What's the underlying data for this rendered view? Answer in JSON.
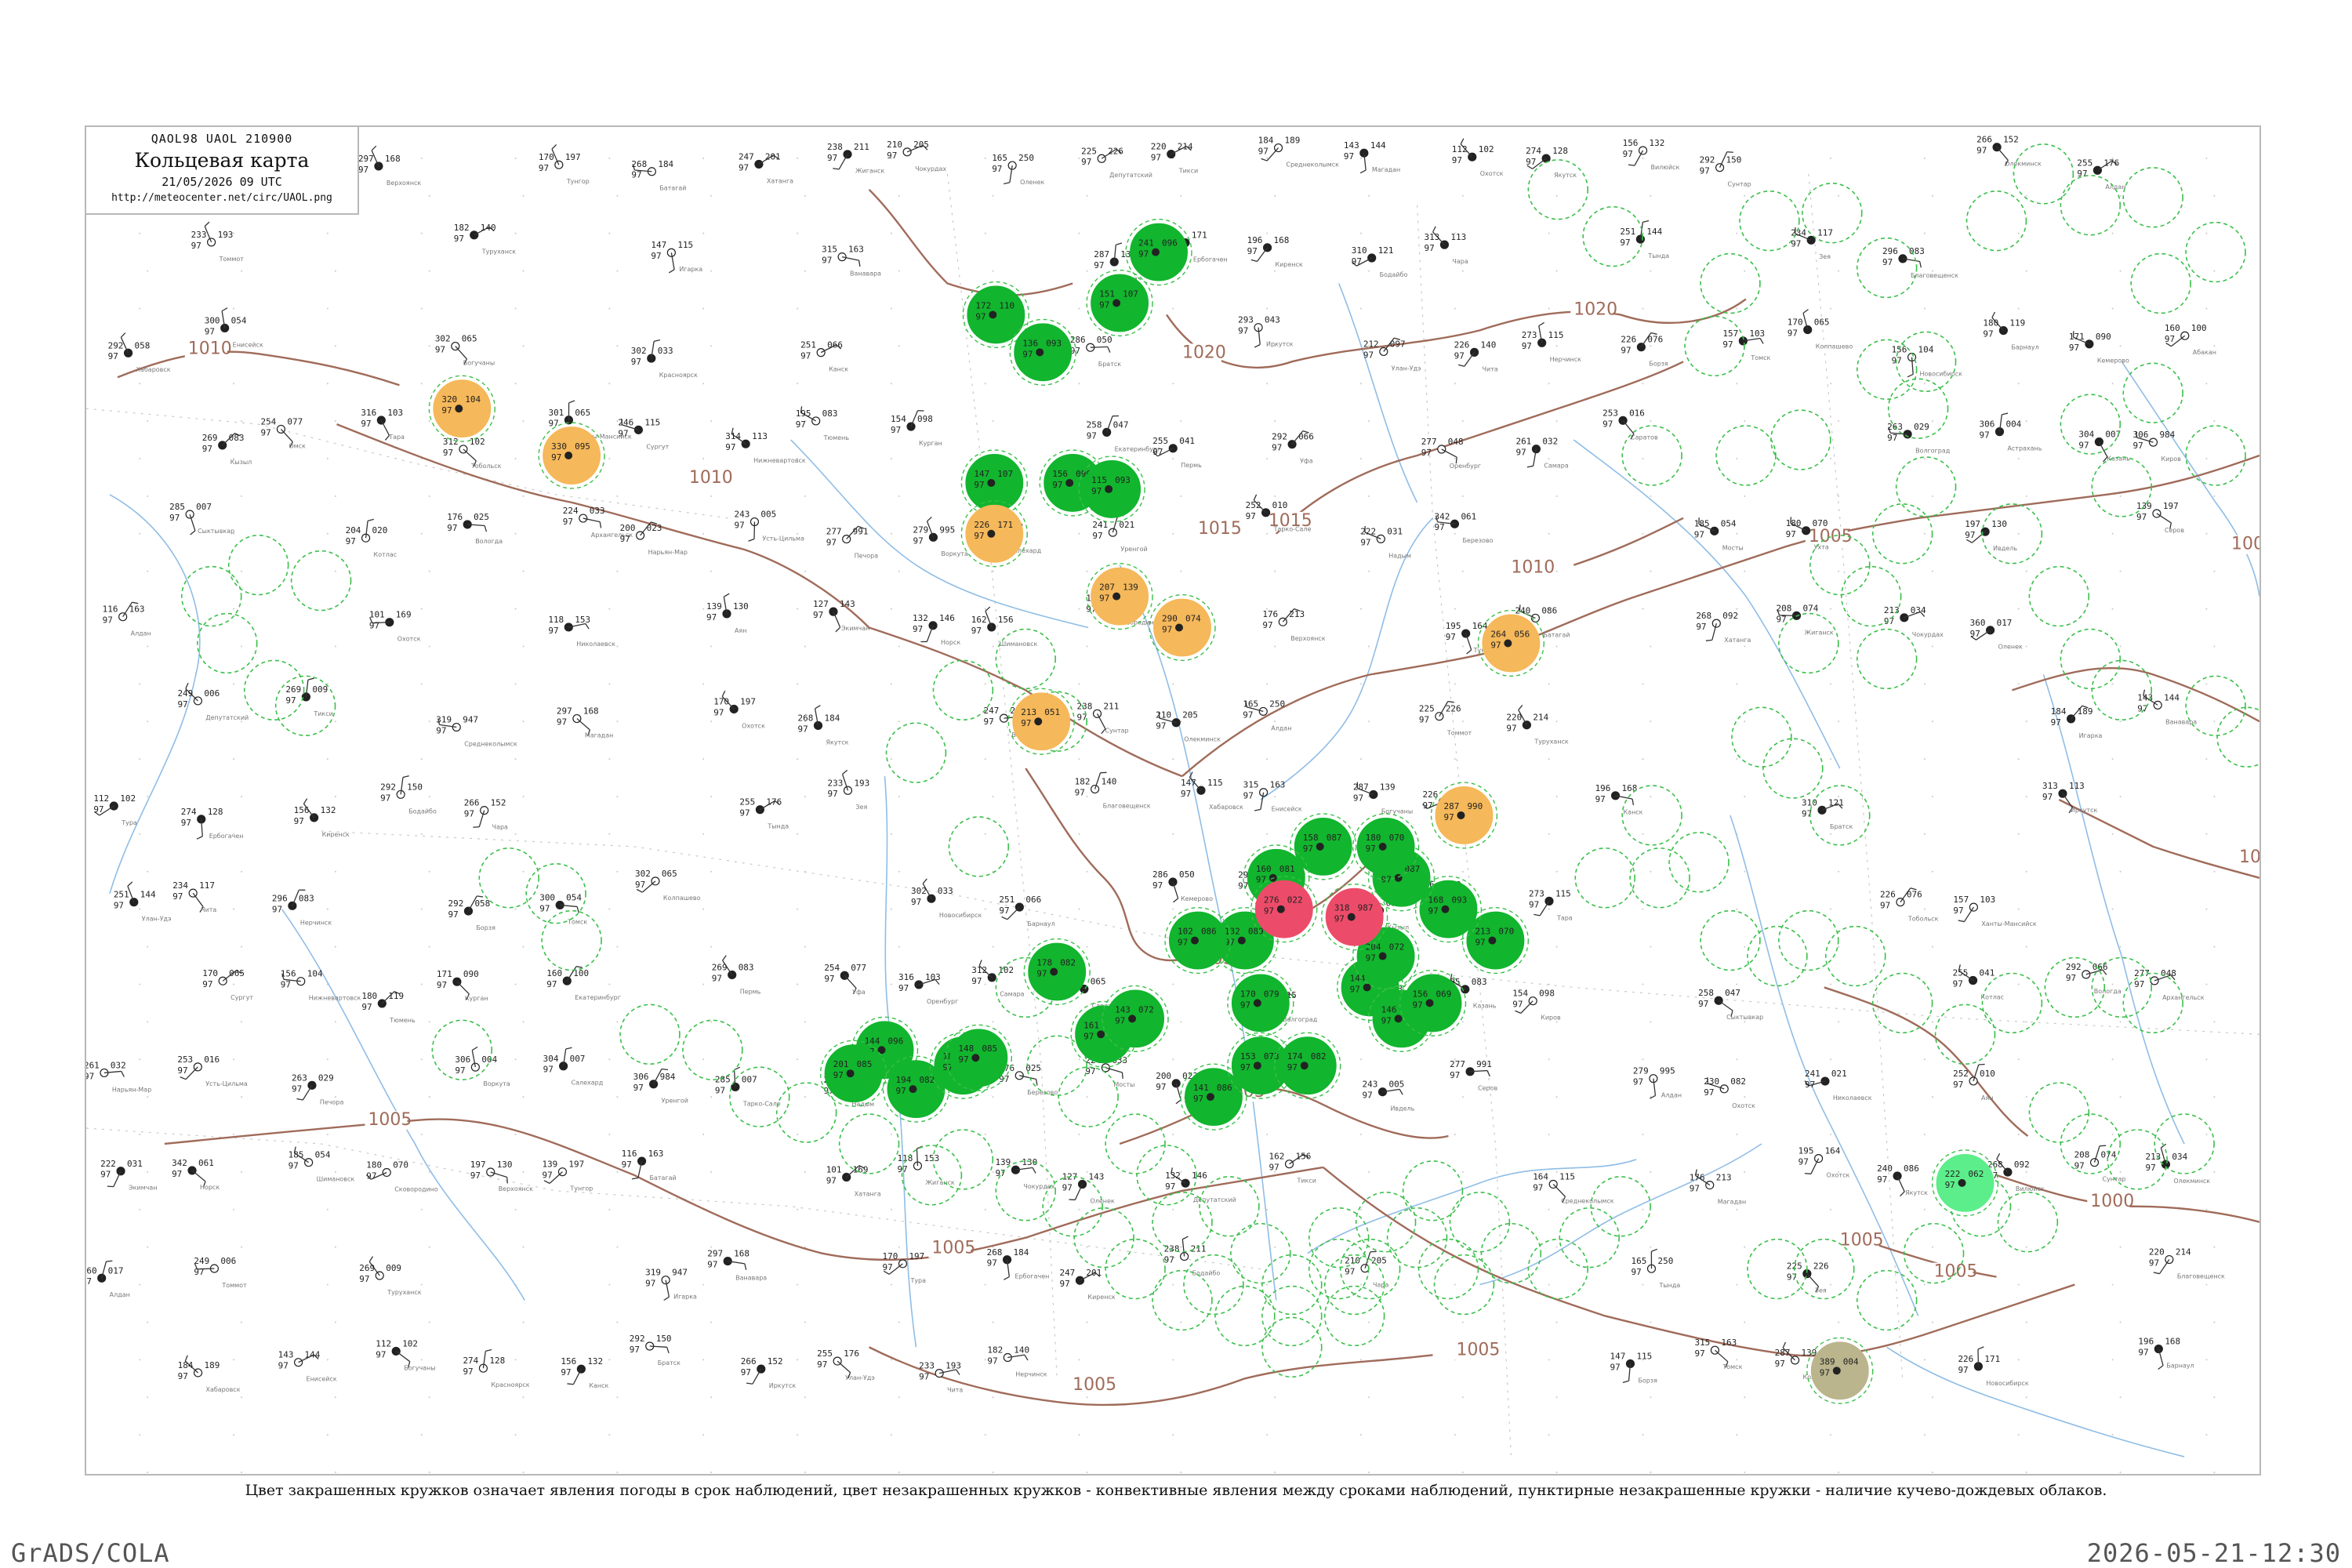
{
  "header": {
    "code": "QAOL98  UAOL  210900",
    "title": "Кольцевая карта",
    "date": "21/05/2026 09 UTC",
    "url": "http://meteocenter.net/circ/UAOL.png"
  },
  "legend_note": "Цвет закрашенных кружков означает явления погоды в срок наблюдений, цвет незакрашенных кружков - конвективные явления между сроками наблюдений, пунктирные незакрашенные кружки - наличие кучево-дождевых облаков.",
  "footer": {
    "left": "GrADS/COLA",
    "right": "2026-05-21-12:30"
  },
  "isobar_labels": [
    "1010",
    "1010",
    "1015",
    "1020",
    "1020",
    "1015",
    "1010",
    "1005",
    "1005",
    "1005",
    "1005",
    "1005",
    "1000",
    "1000",
    "1000",
    "1005",
    "1005",
    "1005",
    "1005"
  ],
  "colors": {
    "isobar": "#a06b5a",
    "river": "#8fbde6",
    "rain_filled": "#12b52e",
    "dust_orange": "#f5b85a",
    "thunder_red": "#ec4c6a",
    "light_green": "#5cee8a",
    "haze_olive": "#bab58c",
    "convective_dashed": "#3bbf4a"
  },
  "stations": {
    "filled": [
      {
        "color": "rain_filled",
        "t": "241",
        "p": "096"
      },
      {
        "color": "rain_filled",
        "t": "151",
        "p": "107"
      },
      {
        "color": "rain_filled",
        "t": "172",
        "p": "110"
      },
      {
        "color": "rain_filled",
        "t": "136",
        "p": "093"
      },
      {
        "color": "rain_filled",
        "t": "147",
        "p": "107"
      },
      {
        "color": "rain_filled",
        "t": "156",
        "p": "096"
      },
      {
        "color": "rain_filled",
        "t": "115",
        "p": "093"
      },
      {
        "color": "rain_filled",
        "t": "144",
        "p": "096"
      },
      {
        "color": "rain_filled",
        "t": "201",
        "p": "085"
      },
      {
        "color": "rain_filled",
        "t": "194",
        "p": "082"
      },
      {
        "color": "rain_filled",
        "t": "182",
        "p": "078"
      },
      {
        "color": "rain_filled",
        "t": "148",
        "p": "085"
      },
      {
        "color": "rain_filled",
        "t": "178",
        "p": "082"
      },
      {
        "color": "rain_filled",
        "t": "161",
        "p": "085"
      },
      {
        "color": "rain_filled",
        "t": "143",
        "p": "072"
      },
      {
        "color": "rain_filled",
        "t": "141",
        "p": "086"
      },
      {
        "color": "rain_filled",
        "t": "153",
        "p": "073"
      },
      {
        "color": "rain_filled",
        "t": "174",
        "p": "082"
      },
      {
        "color": "rain_filled",
        "t": "170",
        "p": "079"
      },
      {
        "color": "rain_filled",
        "t": "144",
        "p": "069"
      },
      {
        "color": "rain_filled",
        "t": "204",
        "p": "072"
      },
      {
        "color": "rain_filled",
        "t": "146",
        "p": "086"
      },
      {
        "color": "rain_filled",
        "t": "156",
        "p": "069"
      },
      {
        "color": "rain_filled",
        "t": "213",
        "p": "070"
      },
      {
        "color": "rain_filled",
        "t": "168",
        "p": "093"
      },
      {
        "color": "rain_filled",
        "t": "160",
        "p": "087"
      },
      {
        "color": "rain_filled",
        "t": "180",
        "p": "070"
      },
      {
        "color": "rain_filled",
        "t": "158",
        "p": "087"
      },
      {
        "color": "rain_filled",
        "t": "160",
        "p": "081"
      },
      {
        "color": "rain_filled",
        "t": "132",
        "p": "089"
      },
      {
        "color": "rain_filled",
        "t": "102",
        "p": "086"
      },
      {
        "color": "dust_orange",
        "t": "320",
        "p": "104"
      },
      {
        "color": "dust_orange",
        "t": "330",
        "p": "095"
      },
      {
        "color": "dust_orange",
        "t": "226",
        "p": "171"
      },
      {
        "color": "dust_orange",
        "t": "207",
        "p": "139"
      },
      {
        "color": "dust_orange",
        "t": "290",
        "p": "074"
      },
      {
        "color": "dust_orange",
        "t": "213",
        "p": "051"
      },
      {
        "color": "dust_orange",
        "t": "264",
        "p": "056"
      },
      {
        "color": "dust_orange",
        "t": "287",
        "p": "990"
      },
      {
        "color": "thunder_red",
        "t": "276",
        "p": "022"
      },
      {
        "color": "thunder_red",
        "t": "318",
        "p": "987"
      },
      {
        "color": "light_green",
        "t": "222",
        "p": "062"
      },
      {
        "color": "haze_olive",
        "t": "389",
        "p": "004"
      }
    ],
    "plots": [
      {
        "t": "297",
        "p": "168"
      },
      {
        "t": "170",
        "p": "197"
      },
      {
        "t": "268",
        "p": "184"
      },
      {
        "t": "247",
        "p": "201"
      },
      {
        "t": "238",
        "p": "211"
      },
      {
        "t": "210",
        "p": "205"
      },
      {
        "t": "165",
        "p": "250"
      },
      {
        "t": "225",
        "p": "226"
      },
      {
        "t": "220",
        "p": "214"
      },
      {
        "t": "184",
        "p": "189"
      },
      {
        "t": "143",
        "p": "144"
      },
      {
        "t": "112",
        "p": "102"
      },
      {
        "t": "274",
        "p": "128"
      },
      {
        "t": "156",
        "p": "132"
      },
      {
        "t": "292",
        "p": "150"
      },
      {
        "t": "266",
        "p": "152"
      },
      {
        "t": "255",
        "p": "176"
      },
      {
        "t": "233",
        "p": "193"
      },
      {
        "t": "182",
        "p": "140"
      },
      {
        "t": "147",
        "p": "115"
      },
      {
        "t": "315",
        "p": "163"
      },
      {
        "t": "287",
        "p": "139"
      },
      {
        "t": "226",
        "p": "171"
      },
      {
        "t": "196",
        "p": "168"
      },
      {
        "t": "310",
        "p": "121"
      },
      {
        "t": "313",
        "p": "113"
      },
      {
        "t": "251",
        "p": "144"
      },
      {
        "t": "234",
        "p": "117"
      },
      {
        "t": "296",
        "p": "083"
      },
      {
        "t": "292",
        "p": "058"
      },
      {
        "t": "300",
        "p": "054"
      },
      {
        "t": "302",
        "p": "065"
      },
      {
        "t": "302",
        "p": "033"
      },
      {
        "t": "251",
        "p": "066"
      },
      {
        "t": "286",
        "p": "050"
      },
      {
        "t": "293",
        "p": "043"
      },
      {
        "t": "212",
        "p": "097"
      },
      {
        "t": "226",
        "p": "140"
      },
      {
        "t": "273",
        "p": "115"
      },
      {
        "t": "226",
        "p": "076"
      },
      {
        "t": "157",
        "p": "103"
      },
      {
        "t": "170",
        "p": "065"
      },
      {
        "t": "156",
        "p": "104"
      },
      {
        "t": "180",
        "p": "119"
      },
      {
        "t": "171",
        "p": "090"
      },
      {
        "t": "160",
        "p": "100"
      },
      {
        "t": "269",
        "p": "083"
      },
      {
        "t": "254",
        "p": "077"
      },
      {
        "t": "316",
        "p": "103"
      },
      {
        "t": "312",
        "p": "102"
      },
      {
        "t": "301",
        "p": "065"
      },
      {
        "t": "246",
        "p": "115"
      },
      {
        "t": "314",
        "p": "113"
      },
      {
        "t": "195",
        "p": "083"
      },
      {
        "t": "154",
        "p": "098"
      },
      {
        "t": "258",
        "p": "047"
      },
      {
        "t": "255",
        "p": "041"
      },
      {
        "t": "292",
        "p": "066"
      },
      {
        "t": "277",
        "p": "048"
      },
      {
        "t": "261",
        "p": "032"
      },
      {
        "t": "253",
        "p": "016"
      },
      {
        "t": "263",
        "p": "029"
      },
      {
        "t": "306",
        "p": "004"
      },
      {
        "t": "304",
        "p": "007"
      },
      {
        "t": "306",
        "p": "984"
      },
      {
        "t": "285",
        "p": "007"
      },
      {
        "t": "204",
        "p": "020"
      },
      {
        "t": "176",
        "p": "025"
      },
      {
        "t": "224",
        "p": "033"
      },
      {
        "t": "200",
        "p": "023"
      },
      {
        "t": "243",
        "p": "005"
      },
      {
        "t": "277",
        "p": "991"
      },
      {
        "t": "279",
        "p": "995"
      },
      {
        "t": "230",
        "p": "082"
      },
      {
        "t": "241",
        "p": "021"
      },
      {
        "t": "252",
        "p": "010"
      },
      {
        "t": "222",
        "p": "031"
      },
      {
        "t": "342",
        "p": "061"
      },
      {
        "t": "185",
        "p": "054"
      },
      {
        "t": "180",
        "p": "070"
      },
      {
        "t": "197",
        "p": "130"
      },
      {
        "t": "139",
        "p": "197"
      },
      {
        "t": "116",
        "p": "163"
      },
      {
        "t": "101",
        "p": "169"
      },
      {
        "t": "118",
        "p": "153"
      },
      {
        "t": "139",
        "p": "130"
      },
      {
        "t": "127",
        "p": "143"
      },
      {
        "t": "132",
        "p": "146"
      },
      {
        "t": "162",
        "p": "156"
      },
      {
        "t": "164",
        "p": "115"
      },
      {
        "t": "176",
        "p": "213"
      },
      {
        "t": "195",
        "p": "164"
      },
      {
        "t": "240",
        "p": "086"
      },
      {
        "t": "268",
        "p": "092"
      },
      {
        "t": "208",
        "p": "074"
      },
      {
        "t": "213",
        "p": "034"
      },
      {
        "t": "360",
        "p": "017"
      },
      {
        "t": "249",
        "p": "006"
      },
      {
        "t": "269",
        "p": "009"
      },
      {
        "t": "319",
        "p": "947"
      }
    ],
    "names": [
      "Верхоянск",
      "Тунгор",
      "Батагай",
      "Хатанга",
      "Жиганск",
      "Чокурдах",
      "Оленек",
      "Депутатский",
      "Тикси",
      "Среднеколымск",
      "Магадан",
      "Охотск",
      "Якутск",
      "Вилюйск",
      "Сунтар",
      "Олекминск",
      "Алдан",
      "Томмот",
      "Туруханск",
      "Игарка",
      "Ванавара",
      "Тура",
      "Ербогачен",
      "Киренск",
      "Бодайбо",
      "Чара",
      "Тында",
      "Зея",
      "Благовещенск",
      "Хабаровск",
      "Енисейск",
      "Богучаны",
      "Красноярск",
      "Канск",
      "Братск",
      "Иркутск",
      "Улан-Удэ",
      "Чита",
      "Нерчинск",
      "Борзя",
      "Томск",
      "Колпашево",
      "Новосибирск",
      "Барнаул",
      "Кемерово",
      "Абакан",
      "Кызыл",
      "Омск",
      "Тара",
      "Тобольск",
      "Ханты-Мансийск",
      "Сургут",
      "Нижневартовск",
      "Тюмень",
      "Курган",
      "Екатеринбург",
      "Пермь",
      "Уфа",
      "Оренбург",
      "Самара",
      "Саратов",
      "Волгоград",
      "Астрахань",
      "Казань",
      "Киров",
      "Сыктывкар",
      "Котлас",
      "Вологда",
      "Архангельск",
      "Нарьян-Мар",
      "Усть-Цильма",
      "Печора",
      "Воркута",
      "Салехард",
      "Уренгой",
      "Тарко-Сале",
      "Надым",
      "Березово",
      "Мосты",
      "Ухта",
      "Ивдель",
      "Серов",
      "Алдан",
      "Охотск",
      "Николаевск",
      "Аян",
      "Экимчан",
      "Норск",
      "Шимановск",
      "Сковородино"
    ]
  }
}
